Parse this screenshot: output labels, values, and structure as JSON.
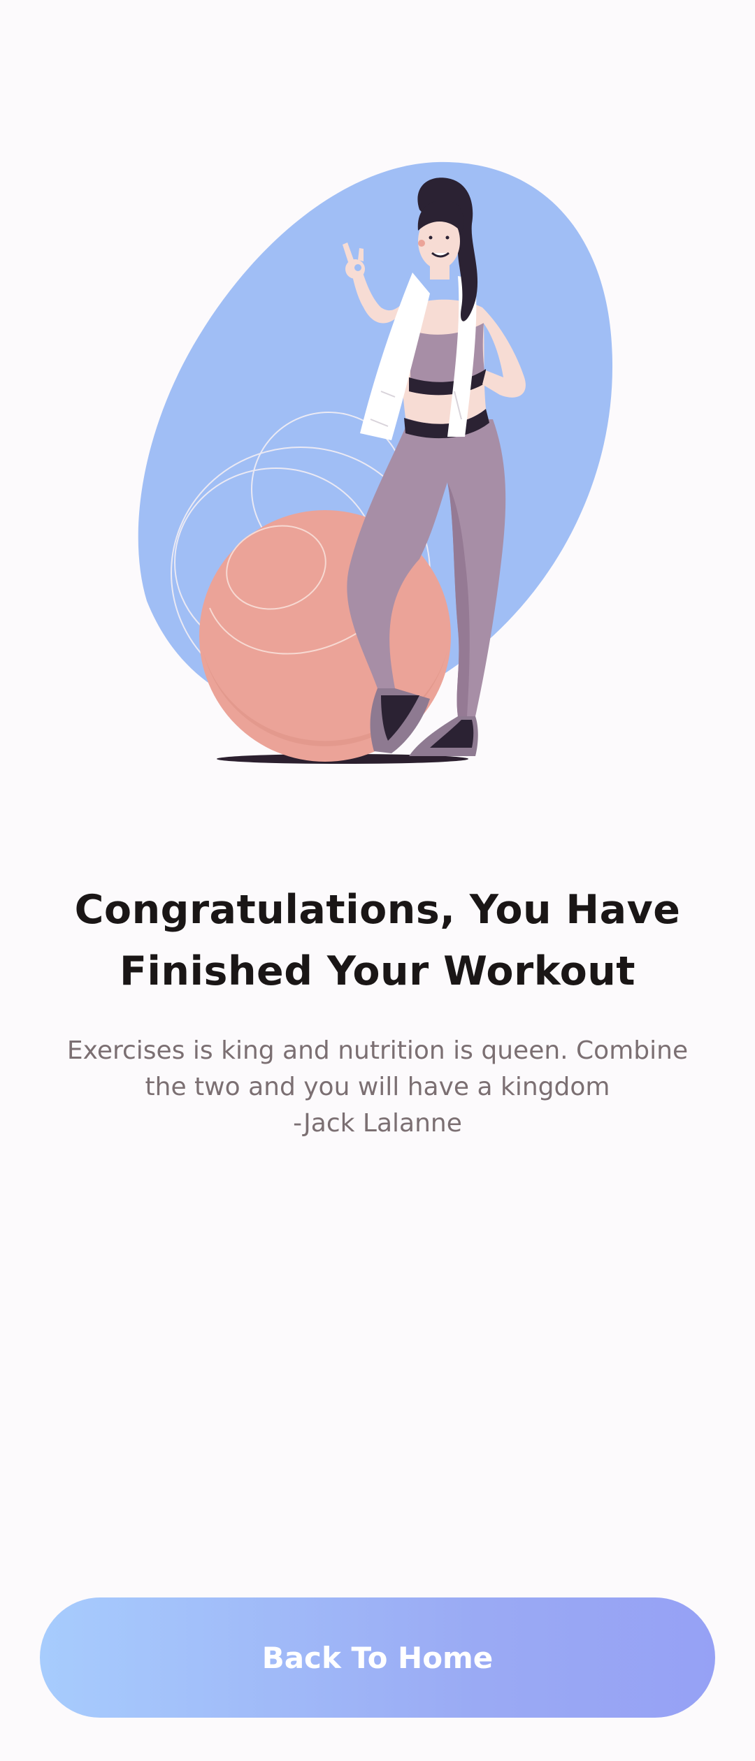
{
  "congrats": {
    "title_line1": "Congratulations, You Have",
    "title_line2": "Finished Your Workout",
    "quote_line1": "Exercises is king and nutrition is queen. Combine",
    "quote_line2": "the two and you will have a kingdom",
    "quote_author": "-Jack Lalanne"
  },
  "actions": {
    "back_home_label": "Back To Home"
  },
  "colors": {
    "background": "#FCFAFC",
    "title": "#1A1616",
    "body_text": "#7B6F72",
    "blob": "#A0BEF5",
    "ball": "#EBA398",
    "outfit": "#A78EA6",
    "button_gradient_start": "#A7CCFD",
    "button_gradient_end": "#96A1F5"
  },
  "icons": {
    "illustration": "woman-with-exercise-ball-illustration"
  }
}
